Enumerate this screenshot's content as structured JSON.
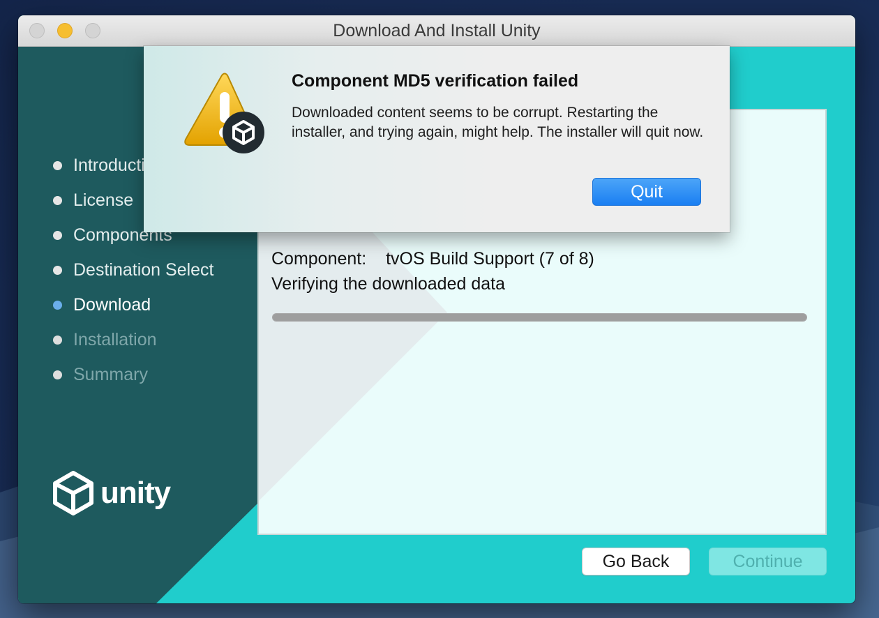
{
  "window": {
    "title": "Download And Install Unity"
  },
  "sidebar": {
    "steps": [
      {
        "label": "Introduction",
        "state": "done"
      },
      {
        "label": "License",
        "state": "done"
      },
      {
        "label": "Components",
        "state": "done"
      },
      {
        "label": "Destination Select",
        "state": "done"
      },
      {
        "label": "Download",
        "state": "active"
      },
      {
        "label": "Installation",
        "state": "future"
      },
      {
        "label": "Summary",
        "state": "future"
      }
    ],
    "logo_text": "unity"
  },
  "main": {
    "component_label": "Component:",
    "component_value": "tvOS Build Support (7 of 8)",
    "status": "Verifying the downloaded data",
    "progress_percent": 100
  },
  "buttons": {
    "back": "Go Back",
    "continue": "Continue"
  },
  "alert": {
    "title": "Component MD5 verification failed",
    "message": "Downloaded content seems to be corrupt. Restarting the installer, and trying again, might help. The installer will quit now.",
    "button": "Quit"
  },
  "colors": {
    "accent": "#20cdcc",
    "sidebar": "#1e5a5e",
    "quit_button": "#1a7ff2",
    "active_step_dot": "#6aaeea"
  },
  "icons": [
    "warning-icon",
    "unity-badge-icon",
    "unity-logo-icon"
  ]
}
